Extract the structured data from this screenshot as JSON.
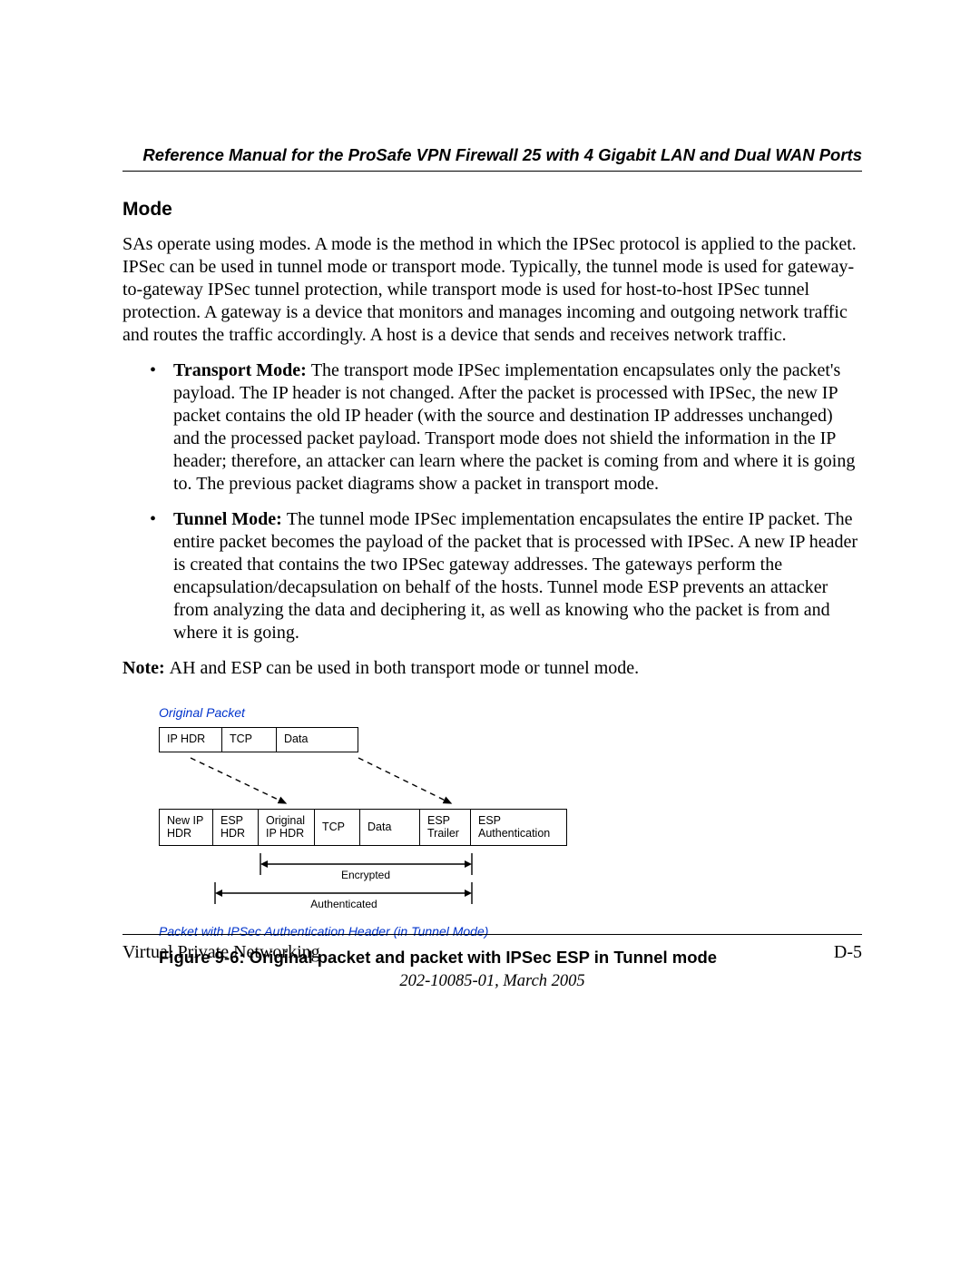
{
  "header": {
    "running_title": "Reference Manual for the ProSafe VPN Firewall 25 with 4 Gigabit LAN and Dual WAN Ports"
  },
  "section": {
    "heading": "Mode",
    "intro": "SAs operate using modes. A mode is the method in which the IPSec protocol is applied to the packet. IPSec can be used in tunnel mode or transport mode. Typically, the tunnel mode is used for gateway-to-gateway IPSec tunnel protection, while transport mode is used for host-to-host IPSec tunnel protection. A gateway is a device that monitors and manages incoming and outgoing network traffic and routes the traffic accordingly. A host is a device that sends and receives network traffic.",
    "bullets": [
      {
        "lead": "Transport Mode: ",
        "body": "The transport mode IPSec implementation encapsulates only the packet's payload. The IP header is not changed. After the packet is processed with IPSec, the new IP packet contains the old IP header (with the source and destination IP addresses unchanged) and the processed packet payload. Transport mode does not shield the information in the IP header; therefore, an attacker can learn where the packet is coming from and where it is going to. The previous packet diagrams show a packet in transport mode."
      },
      {
        "lead": "Tunnel Mode: ",
        "body": "The tunnel mode IPSec implementation encapsulates the entire IP packet. The entire packet becomes the payload of the packet that is processed with IPSec. A new IP header is created that contains the two IPSec gateway addresses. The gateways perform the encapsulation/decapsulation on behalf of the hosts. Tunnel mode ESP prevents an attacker from analyzing the data and deciphering it, as well as knowing who the packet is from and where it is going."
      }
    ],
    "note_lead": "Note: ",
    "note_body": "AH and ESP can be used in both transport mode or tunnel mode."
  },
  "figure": {
    "top_caption": "Original Packet",
    "orig": {
      "ip": "IP HDR",
      "tcp": "TCP",
      "data": "Data"
    },
    "tunnel": {
      "new_ip": "New IP HDR",
      "esp_hdr": "ESP HDR",
      "orig_ip": "Original IP HDR",
      "tcp": "TCP",
      "data": "Data",
      "esp_trailer": "ESP Trailer",
      "esp_auth": "ESP Authentication"
    },
    "encrypted_label": "Encrypted",
    "auth_label": "Authenticated",
    "bottom_caption": "Packet with IPSec Authentication Header (in Tunnel Mode)",
    "caption": "Figure 9-6:  Original packet and packet with IPSec ESP in Tunnel mode"
  },
  "footer": {
    "section_name": "Virtual Private Networking",
    "page_no": "D-5",
    "doc_date": "202-10085-01, March 2005"
  }
}
